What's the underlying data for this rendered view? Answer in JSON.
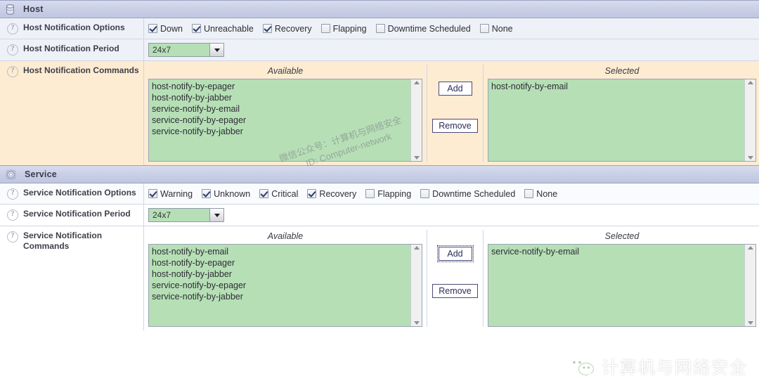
{
  "sections": [
    {
      "id": "host",
      "title": "Host",
      "icon": "database-icon",
      "rows": [
        {
          "id": "host-notification-options",
          "label": "Host Notification Options",
          "type": "checkboxes",
          "tone": "tone-blue",
          "options": [
            {
              "label": "Down",
              "checked": true
            },
            {
              "label": "Unreachable",
              "checked": true
            },
            {
              "label": "Recovery",
              "checked": true
            },
            {
              "label": "Flapping",
              "checked": false
            },
            {
              "label": "Downtime Scheduled",
              "checked": false
            },
            {
              "label": "None",
              "checked": false
            }
          ]
        },
        {
          "id": "host-notification-period",
          "label": "Host Notification Period",
          "type": "select",
          "tone": "tone-blue",
          "value": "24x7"
        },
        {
          "id": "host-notification-commands",
          "label": "Host Notification Commands",
          "type": "picker",
          "tone": "tone-peach",
          "available_caption": "Available",
          "selected_caption": "Selected",
          "add_label": "Add",
          "remove_label": "Remove",
          "add_focused": false,
          "available": [
            "host-notify-by-epager",
            "host-notify-by-jabber",
            "service-notify-by-email",
            "service-notify-by-epager",
            "service-notify-by-jabber"
          ],
          "selected": [
            "host-notify-by-email"
          ]
        }
      ]
    },
    {
      "id": "service",
      "title": "Service",
      "icon": "gear-icon",
      "rows": [
        {
          "id": "service-notification-options",
          "label": "Service Notification Options",
          "type": "checkboxes",
          "tone": "tone-white",
          "options": [
            {
              "label": "Warning",
              "checked": true
            },
            {
              "label": "Unknown",
              "checked": true
            },
            {
              "label": "Critical",
              "checked": true
            },
            {
              "label": "Recovery",
              "checked": true
            },
            {
              "label": "Flapping",
              "checked": false
            },
            {
              "label": "Downtime Scheduled",
              "checked": false
            },
            {
              "label": "None",
              "checked": false
            }
          ]
        },
        {
          "id": "service-notification-period",
          "label": "Service Notification Period",
          "type": "select",
          "tone": "tone-white2",
          "value": "24x7"
        },
        {
          "id": "service-notification-commands",
          "label": "Service Notification Commands",
          "type": "picker",
          "tone": "tone-white2",
          "available_caption": "Available",
          "selected_caption": "Selected",
          "add_label": "Add",
          "remove_label": "Remove",
          "add_focused": true,
          "available": [
            "host-notify-by-email",
            "host-notify-by-epager",
            "host-notify-by-jabber",
            "service-notify-by-epager",
            "service-notify-by-jabber"
          ],
          "selected": [
            "service-notify-by-email"
          ]
        }
      ]
    }
  ],
  "watermark": {
    "line1": "微信公众号：计算机与网络安全",
    "line2": "ID: Computer-network",
    "logo_text": "计算机与网络安全",
    "logo_icon": "wechat-icon"
  },
  "help_icon_glyph": "?",
  "colors": {
    "header_bg": "#c9cfe6",
    "field_green": "#b6dfb6",
    "row_blue": "#eef1f8",
    "row_peach": "#fdecd2",
    "button_border": "#4a4a7a"
  }
}
